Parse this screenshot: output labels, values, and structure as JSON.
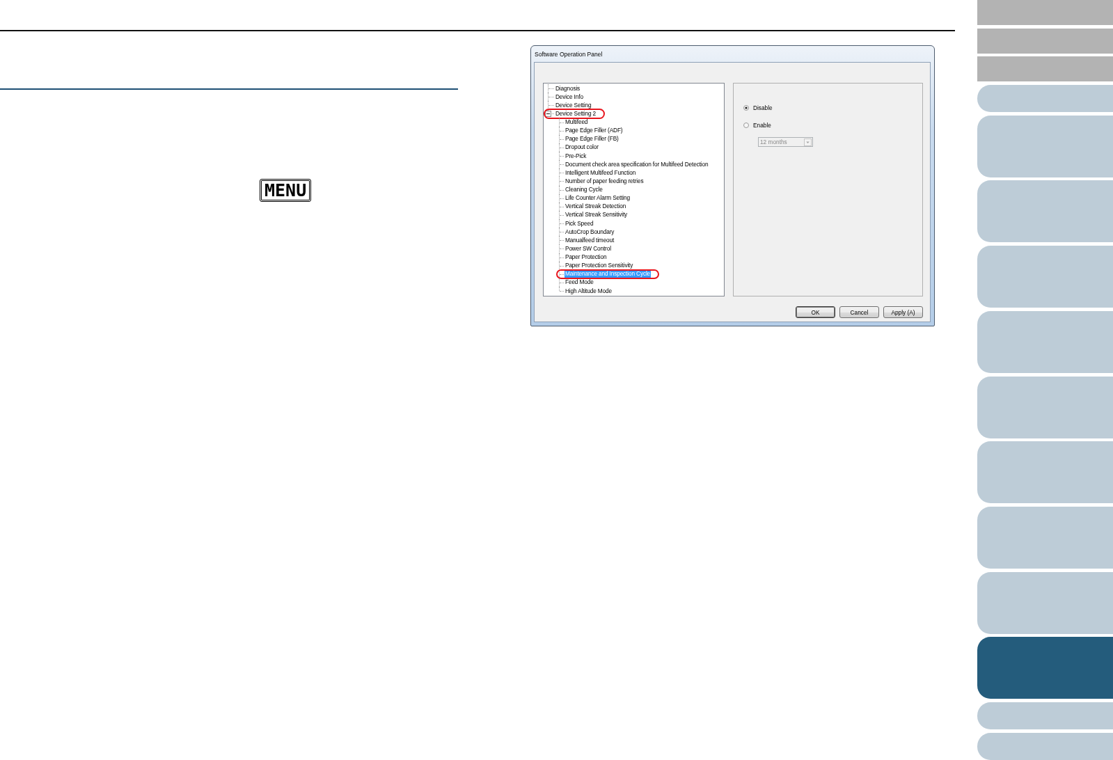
{
  "menu_key": {
    "label": "MENU"
  },
  "dialog": {
    "title": "Software Operation Panel",
    "tree": [
      {
        "label": "Diagnosis",
        "selected": false,
        "circled": false
      },
      {
        "label": "Device Info",
        "selected": false,
        "circled": false
      },
      {
        "label": "Device Setting",
        "selected": false,
        "circled": false
      },
      {
        "label": "Device Setting 2",
        "selected": false,
        "circled": true,
        "expanded": true,
        "children": [
          {
            "label": "Multifeed",
            "selected": false,
            "circled": false
          },
          {
            "label": "Page Edge Filler (ADF)",
            "selected": false,
            "circled": false
          },
          {
            "label": "Page Edge Filler (FB)",
            "selected": false,
            "circled": false
          },
          {
            "label": "Dropout color",
            "selected": false,
            "circled": false
          },
          {
            "label": "Pre-Pick",
            "selected": false,
            "circled": false
          },
          {
            "label": "Document check area specification for Multifeed Detection",
            "selected": false,
            "circled": false
          },
          {
            "label": "Intelligent Multifeed Function",
            "selected": false,
            "circled": false
          },
          {
            "label": "Number of paper feeding retries",
            "selected": false,
            "circled": false
          },
          {
            "label": "Cleaning Cycle",
            "selected": false,
            "circled": false
          },
          {
            "label": "Life Counter Alarm Setting",
            "selected": false,
            "circled": false
          },
          {
            "label": "Vertical Streak Detection",
            "selected": false,
            "circled": false
          },
          {
            "label": "Vertical Streak Sensitivity",
            "selected": false,
            "circled": false
          },
          {
            "label": "Pick Speed",
            "selected": false,
            "circled": false
          },
          {
            "label": "AutoCrop Boundary",
            "selected": false,
            "circled": false
          },
          {
            "label": "Manualfeed timeout",
            "selected": false,
            "circled": false
          },
          {
            "label": "Power SW Control",
            "selected": false,
            "circled": false
          },
          {
            "label": "Paper Protection",
            "selected": false,
            "circled": false
          },
          {
            "label": "Paper Protection Sensitivity",
            "selected": false,
            "circled": false
          },
          {
            "label": "Maintenance and Inspection Cycle",
            "selected": true,
            "circled": true
          },
          {
            "label": "Feed Mode",
            "selected": false,
            "circled": false
          },
          {
            "label": "High Altitude Mode",
            "selected": false,
            "circled": false
          }
        ]
      }
    ],
    "options": [
      {
        "label": "Disable",
        "selected": true
      },
      {
        "label": "Enable",
        "selected": false
      }
    ],
    "interval": {
      "value": "12 months",
      "disabled": true
    },
    "buttons": [
      "OK",
      "Cancel",
      "Apply (A)"
    ]
  },
  "side_tabs": [
    {
      "kind": "plain",
      "selected": false
    },
    {
      "kind": "plain",
      "selected": false
    },
    {
      "kind": "plain",
      "selected": false
    },
    {
      "kind": "short",
      "selected": false
    },
    {
      "kind": "tall",
      "selected": false
    },
    {
      "kind": "tall",
      "selected": false
    },
    {
      "kind": "tall",
      "selected": false
    },
    {
      "kind": "tall",
      "selected": false
    },
    {
      "kind": "tall",
      "selected": false
    },
    {
      "kind": "tall",
      "selected": false
    },
    {
      "kind": "tall",
      "selected": false
    },
    {
      "kind": "tall",
      "selected": false
    },
    {
      "kind": "tall",
      "selected": true
    },
    {
      "kind": "short",
      "selected": false
    },
    {
      "kind": "short",
      "selected": false
    }
  ]
}
